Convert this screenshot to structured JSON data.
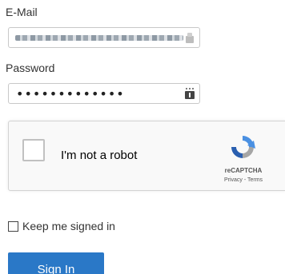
{
  "email": {
    "label": "E-Mail",
    "value_obscured": true
  },
  "password": {
    "label": "Password",
    "value": "•••••••••••••",
    "icon": "password-manager-icon"
  },
  "captcha": {
    "checkbox_label": "I'm not a robot",
    "brand": "reCAPTCHA",
    "links": "Privacy - Terms",
    "logo_icon": "recaptcha-logo-icon",
    "checked": false
  },
  "remember": {
    "label": "Keep me signed in",
    "checked": false
  },
  "submit": {
    "label": "Sign In"
  },
  "colors": {
    "button": "#2a78c7",
    "captcha_bg": "#f9f9f9",
    "recaptcha_blue": "#4a90e2",
    "recaptcha_gray": "#a6a6a6"
  }
}
